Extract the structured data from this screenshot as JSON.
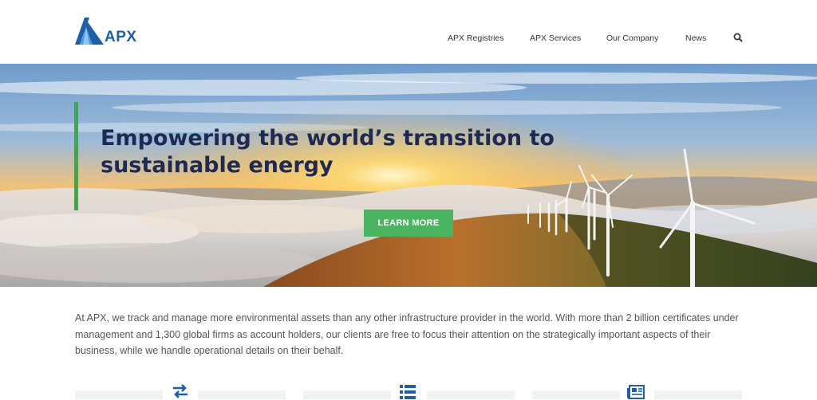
{
  "brand": {
    "name": "APX",
    "logo_icon": "apx-logo-icon",
    "color": "#1d5fa8"
  },
  "nav": {
    "items": [
      {
        "label": "APX Registries"
      },
      {
        "label": "APX Services"
      },
      {
        "label": "Our Company"
      },
      {
        "label": "News"
      }
    ],
    "search_icon": "search-icon"
  },
  "hero": {
    "title": "Empowering the world’s transition to sustainable energy",
    "button_label": "LEARN MORE",
    "accent_color": "#3daa4a",
    "title_color": "#1e2a52"
  },
  "intro": {
    "text": "At APX, we track and manage more environmental assets than any other infrastructure provider in the world. With more than 2 billion certificates under management and 1,300 global firms as account holders, our clients are free to focus their attention on the strategically important aspects of their business, while we handle operational details on their behalf."
  },
  "features": {
    "icons": [
      "transfer-arrows-icon",
      "list-icon",
      "newspaper-icon"
    ]
  }
}
